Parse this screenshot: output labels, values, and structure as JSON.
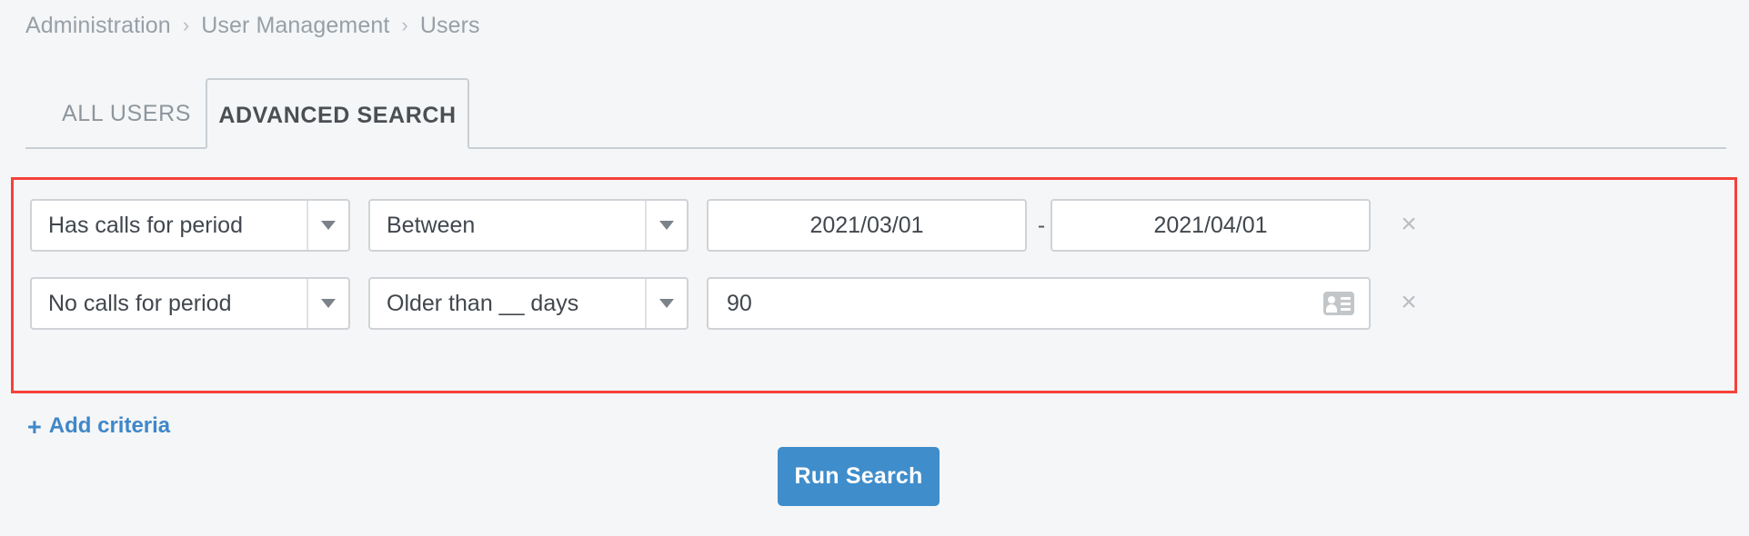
{
  "breadcrumb": {
    "separator": "›",
    "items": [
      {
        "label": "Administration"
      },
      {
        "label": "User Management"
      },
      {
        "label": "Users"
      }
    ]
  },
  "tabs": [
    {
      "label": "ALL USERS",
      "active": false
    },
    {
      "label": "ADVANCED SEARCH",
      "active": true
    }
  ],
  "criteria": {
    "highlight_color": "#f4423a",
    "rows": [
      {
        "field": "Has calls for period",
        "operator": "Between",
        "value_from": "2021/03/01",
        "range_separator": "-",
        "value_to": "2021/04/01",
        "remove_label": "×"
      },
      {
        "field": "No calls for period",
        "operator": "Older than __ days",
        "value": "90",
        "value_icon": "id-card-icon",
        "remove_label": "×"
      }
    ]
  },
  "add_criteria": {
    "plus": "+",
    "label": "Add criteria",
    "color": "#3f87c8"
  },
  "run_search": {
    "label": "Run Search",
    "color": "#3f8dcb"
  }
}
